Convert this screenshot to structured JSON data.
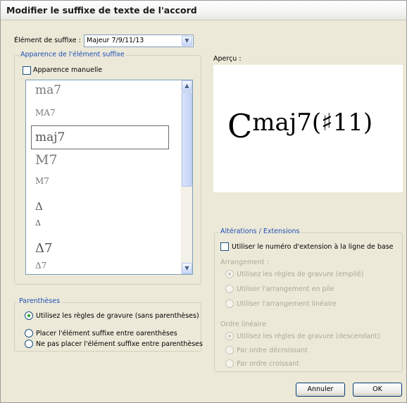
{
  "dialog": {
    "title": "Modifier le suffixe de texte de l'accord"
  },
  "suffix_element": {
    "label": "Élément de suffixe :",
    "value": "Majeur 7/9/11/13"
  },
  "appearance_group": {
    "legend": "Apparence de l'élément suffixe",
    "manual_label": "Apparence manuelle",
    "list_items": [
      {
        "text": "ma7",
        "size": "big"
      },
      {
        "text": "MA7",
        "size": "small"
      },
      {
        "text": "maj7",
        "size": "big",
        "selected": true
      },
      {
        "text": "M7",
        "size": "big"
      },
      {
        "text": "M7",
        "size": "small"
      },
      {
        "text": "Δ",
        "size": "small"
      },
      {
        "text": "Δ",
        "size": "small"
      },
      {
        "text": "Δ7",
        "size": "big"
      },
      {
        "text": "Δ7",
        "size": "small"
      }
    ]
  },
  "preview": {
    "label": "Aperçu :",
    "root": "C",
    "suffix": "maj7(",
    "sharp": "♯",
    "extension": "11)"
  },
  "parentheses_group": {
    "legend": "Parenthèses",
    "options": [
      "Utilisez les règles de gravure (sans parenthèses)",
      "Placer l'élément suffixe entre oarenthèses",
      "Ne pas placer l'élément suffixe entre parenthèses"
    ]
  },
  "alterations_group": {
    "legend": "Altérations / Extensions",
    "baseline_label": "Utiliser le numéro d'extension à la ligne de base",
    "arrangement_label": "Arrangement :",
    "arrangement_options": [
      "Utilisez les règles de gravure (empilé)",
      "Utiliser l'arrangement en pile",
      "Utiliser l'arrangement linéaire"
    ],
    "order_label": "Ordre linéaire",
    "order_options": [
      "Utilisez les règles de gravure (descendant)",
      "Par ordre décroissant",
      "Par ordre croissant"
    ]
  },
  "buttons": {
    "cancel": "Annuler",
    "ok": "OK"
  },
  "colors": {
    "accent": "#1f4fb6",
    "radio_dot": "#21a121",
    "dialog_bg": "#ece9d8"
  }
}
